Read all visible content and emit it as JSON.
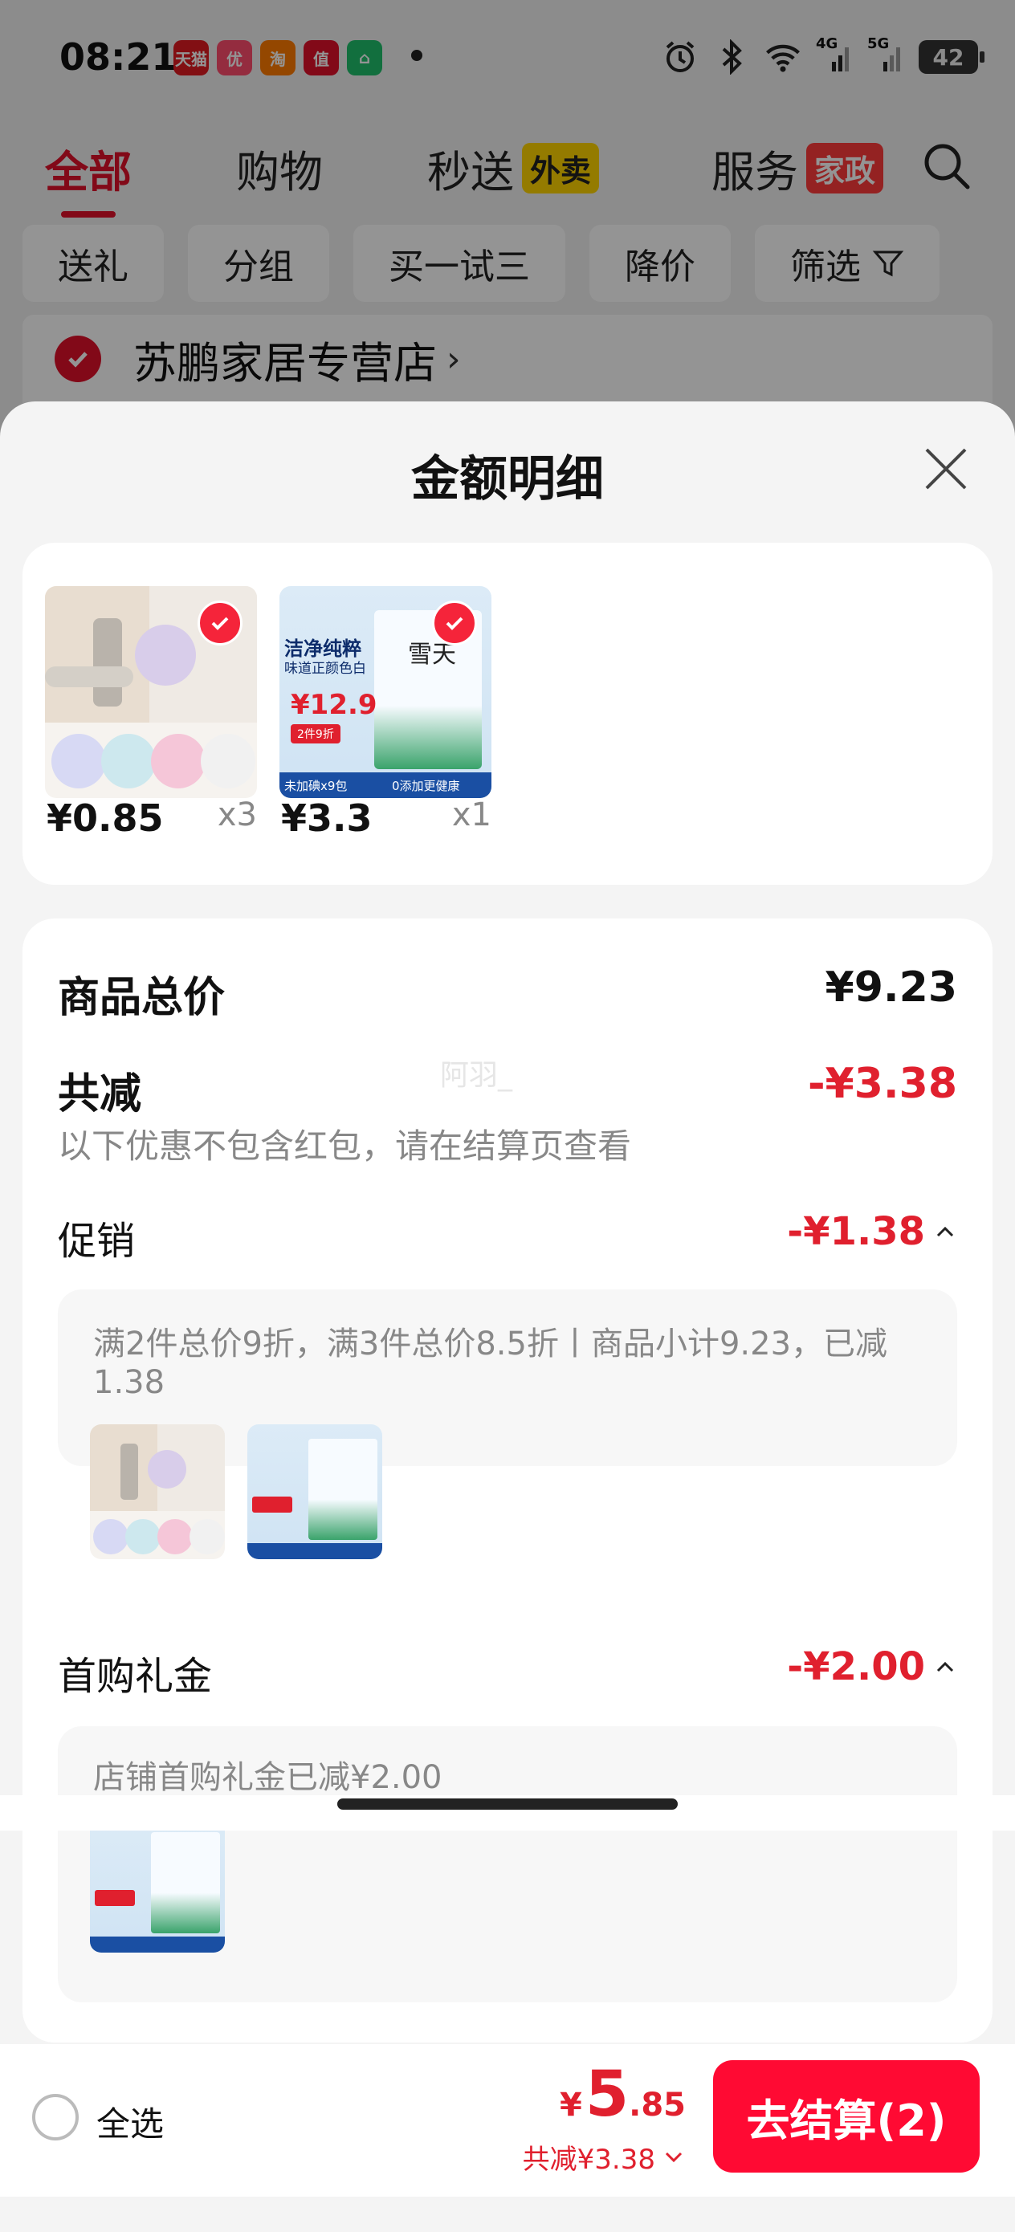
{
  "status_bar": {
    "time": "08:21",
    "app_badges": [
      {
        "label": "天猫",
        "color": "#e01b22"
      },
      {
        "label": "优",
        "color": "#ff4d6d"
      },
      {
        "label": "淘",
        "color": "#ff7a00"
      },
      {
        "label": "值",
        "color": "#e0102a"
      },
      {
        "label": "⌂",
        "color": "#1fbf6b"
      }
    ],
    "network_4g": "4G",
    "network_5g": "5G",
    "battery": "42"
  },
  "background_page": {
    "tabs": [
      {
        "label": "全部",
        "active": true
      },
      {
        "label": "购物",
        "active": false
      },
      {
        "label": "秒送",
        "tag": "外卖",
        "active": false
      },
      {
        "label": "服务",
        "tag": "家政",
        "active": false
      }
    ],
    "filters": [
      "送礼",
      "分组",
      "买一试三",
      "降价",
      "筛选"
    ],
    "store_name": "苏鹏家居专营店",
    "store_arrow": "›"
  },
  "sheet": {
    "title": "金额明细",
    "products": [
      {
        "price": "¥0.85",
        "qty": "x3",
        "image": "door-stopper"
      },
      {
        "price": "¥3.3",
        "qty": "x1",
        "image": "salt-pack"
      }
    ],
    "total_label": "商品总价",
    "total_value": "¥9.23",
    "discount_label": "共减",
    "discount_value": "-¥3.38",
    "watermark": "阿羽_",
    "discount_note": "以下优惠不包含红包，请在结算页查看",
    "promo": {
      "label": "促销",
      "value": "-¥1.38",
      "desc": "满2件总价9折，满3件总价8.5折丨商品小计9.23，已减1.38"
    },
    "first_gift": {
      "label": "首购礼金",
      "value": "-¥2.00",
      "desc": "店铺首购礼金已减¥2.00"
    },
    "image_text": {
      "salt_headline": "洁净纯粹",
      "salt_sub": "味道正颜色白",
      "salt_price": "¥12.9",
      "salt_deal": "2件9折",
      "salt_foot_left": "未加碘x9包",
      "salt_foot_right": "0添加更健康",
      "salt_brand": "雪天"
    }
  },
  "bottom_bar": {
    "select_all": "全选",
    "price_yen": "¥",
    "price_int": "5",
    "price_dec": ".85",
    "saved": "共减¥3.38",
    "checkout": "去结算(2)"
  },
  "colors": {
    "accent": "#e0102a",
    "price_red": "#e0202e",
    "checkout_bg": "#ff0a33"
  }
}
